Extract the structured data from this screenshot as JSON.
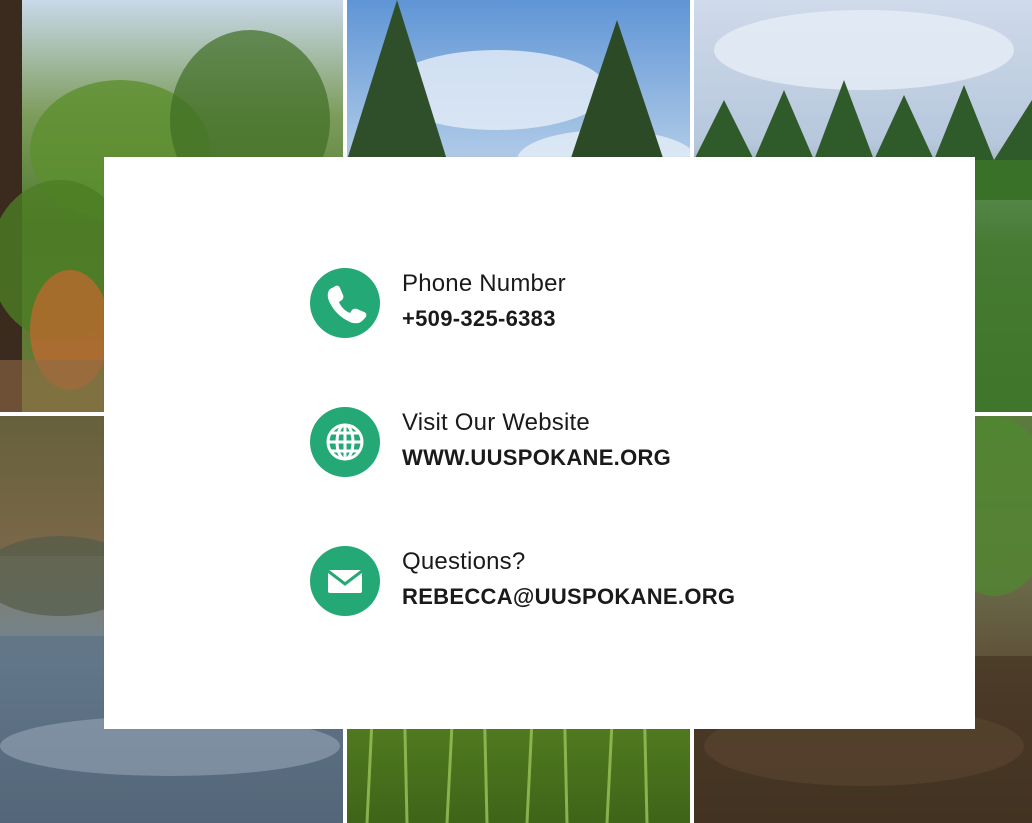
{
  "colors": {
    "accent": "#24a876",
    "card": "#ffffff",
    "text": "#1a1a1a"
  },
  "contacts": [
    {
      "icon": "phone-icon",
      "label": "Phone Number",
      "value": "+509-325-6383"
    },
    {
      "icon": "globe-icon",
      "label": "Visit Our Website",
      "value": "WWW.UUSPOKANE.ORG"
    },
    {
      "icon": "envelope-icon",
      "label": "Questions?",
      "value": "REBECCA@UUSPOKANE.ORG"
    }
  ],
  "background_photos": [
    {
      "subject": "forest-trees"
    },
    {
      "subject": "evergreens-sky"
    },
    {
      "subject": "treeline-clouds"
    },
    {
      "subject": "creek-rocks"
    },
    {
      "subject": "tall-grass"
    },
    {
      "subject": "forest-floor"
    }
  ]
}
